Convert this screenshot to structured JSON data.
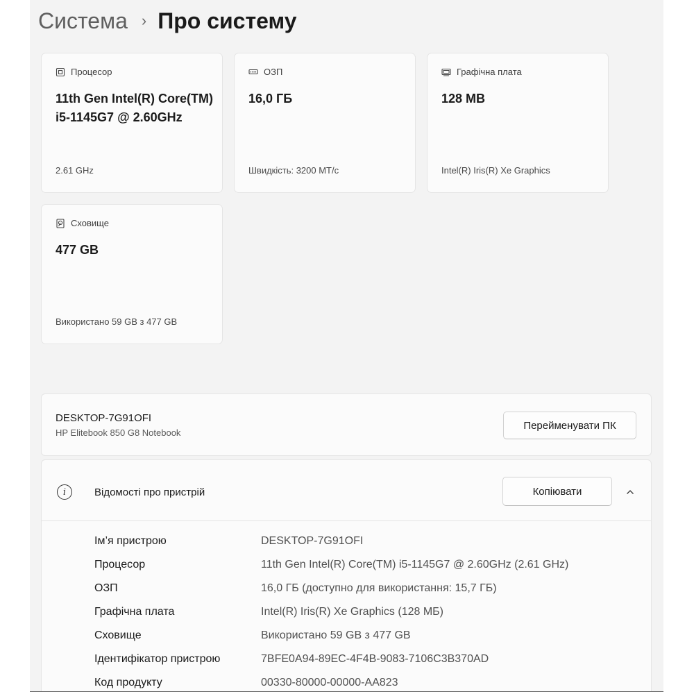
{
  "breadcrumb": {
    "parent": "Система",
    "separator": "›",
    "current": "Про систему"
  },
  "cards": {
    "cpu": {
      "icon": "processor-icon",
      "label": "Процесор",
      "value": "11th Gen Intel(R) Core(TM) i5-1145G7 @ 2.60GHz",
      "sub": "2.61 GHz"
    },
    "ram": {
      "icon": "ram-icon",
      "label": "ОЗП",
      "value": "16,0 ГБ",
      "sub": "Швидкість: 3200 МТ/с"
    },
    "gpu": {
      "icon": "graphics-card-icon",
      "label": "Графічна плата",
      "value": "128 MB",
      "sub": "Intel(R) Iris(R) Xe Graphics"
    },
    "storage": {
      "icon": "storage-icon",
      "label": "Сховище",
      "value": "477 GB",
      "sub": "Використано 59 GB з 477 GB"
    }
  },
  "pc": {
    "name": "DESKTOP-7G91OFI",
    "model": "HP Elitebook 850 G8 Notebook",
    "rename_label": "Перейменувати ПК"
  },
  "device_info": {
    "icon": "info-icon",
    "icon_glyph": "i",
    "title": "Відомості про пристрій",
    "copy_label": "Копіювати",
    "collapse_icon": "chevron-up-icon",
    "rows": [
      {
        "label": "Ім’я пристрою",
        "value": "DESKTOP-7G91OFI"
      },
      {
        "label": "Процесор",
        "value": "11th Gen Intel(R) Core(TM) i5-1145G7 @ 2.60GHz (2.61 GHz)"
      },
      {
        "label": "ОЗП",
        "value": "16,0 ГБ (доступно для використання: 15,7 ГБ)"
      },
      {
        "label": "Графічна плата",
        "value": "Intel(R) Iris(R) Xe Graphics (128 МБ)"
      },
      {
        "label": "Сховище",
        "value": "Використано 59 GB з 477 GB"
      },
      {
        "label": "Ідентифікатор пристрою",
        "value": "7BFE0A94-89EC-4F4B-9083-7106C3B370AD"
      },
      {
        "label": "Код продукту",
        "value": "00330-80000-00000-AA823"
      }
    ]
  }
}
